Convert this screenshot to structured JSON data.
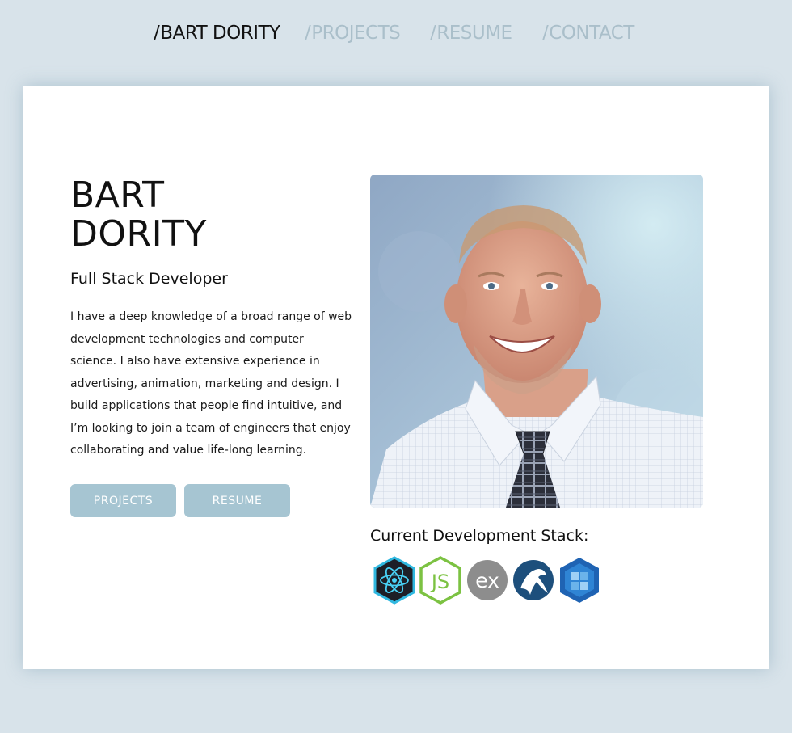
{
  "nav": {
    "items": [
      {
        "slash": "/",
        "label": "BART DORITY",
        "active": true
      },
      {
        "slash": "/",
        "label": "PROJECTS",
        "active": false
      },
      {
        "slash": "/",
        "label": "RESUME",
        "active": false
      },
      {
        "slash": "/",
        "label": "CONTACT",
        "active": false
      }
    ]
  },
  "hero": {
    "name_line1": "BART",
    "name_line2": "DORITY",
    "subtitle": "Full Stack Developer",
    "bio": "I have a deep knowledge of a broad range of web development technologies and computer science. I also have extensive experience in advertising, animation, marketing and design. I build applications that people find intuitive, and I’m looking to join a team of engineers that enjoy collaborating and value life-long learning.",
    "buttons": {
      "projects": "PROJECTS",
      "resume": "RESUME"
    }
  },
  "stack": {
    "title": "Current Development Stack:",
    "icons": [
      {
        "name": "react-icon"
      },
      {
        "name": "nodejs-icon"
      },
      {
        "name": "express-icon",
        "text": "ex"
      },
      {
        "name": "mysql-icon"
      },
      {
        "name": "sequelize-icon"
      }
    ]
  },
  "colors": {
    "background": "#d8e3ea",
    "nav_inactive": "#aabfca",
    "button": "#a6c5d2",
    "text": "#111111"
  }
}
